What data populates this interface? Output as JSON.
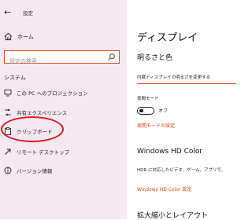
{
  "window": {
    "title": "設定"
  },
  "sidebar": {
    "home_label": "ホーム",
    "search_placeholder": "設定の検索",
    "section_label": "システム",
    "items": [
      {
        "label": "この PC へのプロジェクション",
        "icon": "projection-icon"
      },
      {
        "label": "共有エクスペリエンス",
        "icon": "shared-experiences-icon"
      },
      {
        "label": "クリップボード",
        "icon": "clipboard-icon"
      },
      {
        "label": "リモート デスクトップ",
        "icon": "remote-desktop-icon"
      },
      {
        "label": "バージョン情報",
        "icon": "info-icon"
      }
    ]
  },
  "main": {
    "title": "ディスプレイ",
    "brightness_heading": "明るさと色",
    "brightness_label": "内蔵ディスプレイの明るさを変更する",
    "night_light_label": "夜間モード",
    "night_light_state": "オフ",
    "night_light_settings_link": "夜間モードの設定",
    "hd_color_heading": "Windows HD Color",
    "hd_color_desc": "HDR に対応したビデオ、ゲーム、アプリで、",
    "hd_color_link": "Windows HD Color 設定",
    "scale_heading": "拡大縮小とレイアウト"
  },
  "colors": {
    "accent": "#e0522f",
    "highlight_circle": "#e01b24",
    "sidebar_bg": "#f5e8f0"
  }
}
